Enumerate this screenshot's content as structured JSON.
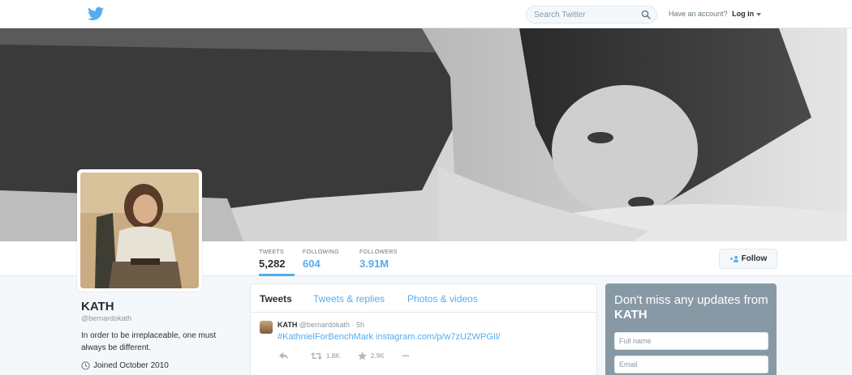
{
  "topbar": {
    "search_placeholder": "Search Twitter",
    "account_prompt": "Have an account?",
    "login_label": "Log in"
  },
  "profile": {
    "name": "KATH",
    "handle": "@bernardokath",
    "bio": "In order to be irreplaceable, one must always be different.",
    "joined": "Joined October 2010"
  },
  "stats": [
    {
      "label": "TWEETS",
      "value": "5,282"
    },
    {
      "label": "FOLLOWING",
      "value": "604"
    },
    {
      "label": "FOLLOWERS",
      "value": "3.91M"
    }
  ],
  "follow_label": "Follow",
  "timeline": {
    "tabs": [
      "Tweets",
      "Tweets & replies",
      "Photos & videos"
    ],
    "tweet": {
      "name": "KATH",
      "meta": "@bernardokath · 5h",
      "text": "#KathnielForBenchMark instagram.com/p/w7zUZWPGIl/",
      "retweets": "1.8K",
      "favorites": "2.9K",
      "more": "•••"
    }
  },
  "signup": {
    "title_prefix": "Don't miss any updates from",
    "title_name": "KATH",
    "fullname_placeholder": "Full name",
    "email_placeholder": "Email"
  },
  "colors": {
    "accent": "#55acee",
    "text": "#292f33",
    "muted": "#8899a6",
    "signup_bg": "#8899a6"
  },
  "icons": [
    "twitter-bird-icon",
    "search-icon",
    "add-person-icon",
    "clock-icon",
    "reply-icon",
    "retweet-icon",
    "favorite-star-icon"
  ]
}
